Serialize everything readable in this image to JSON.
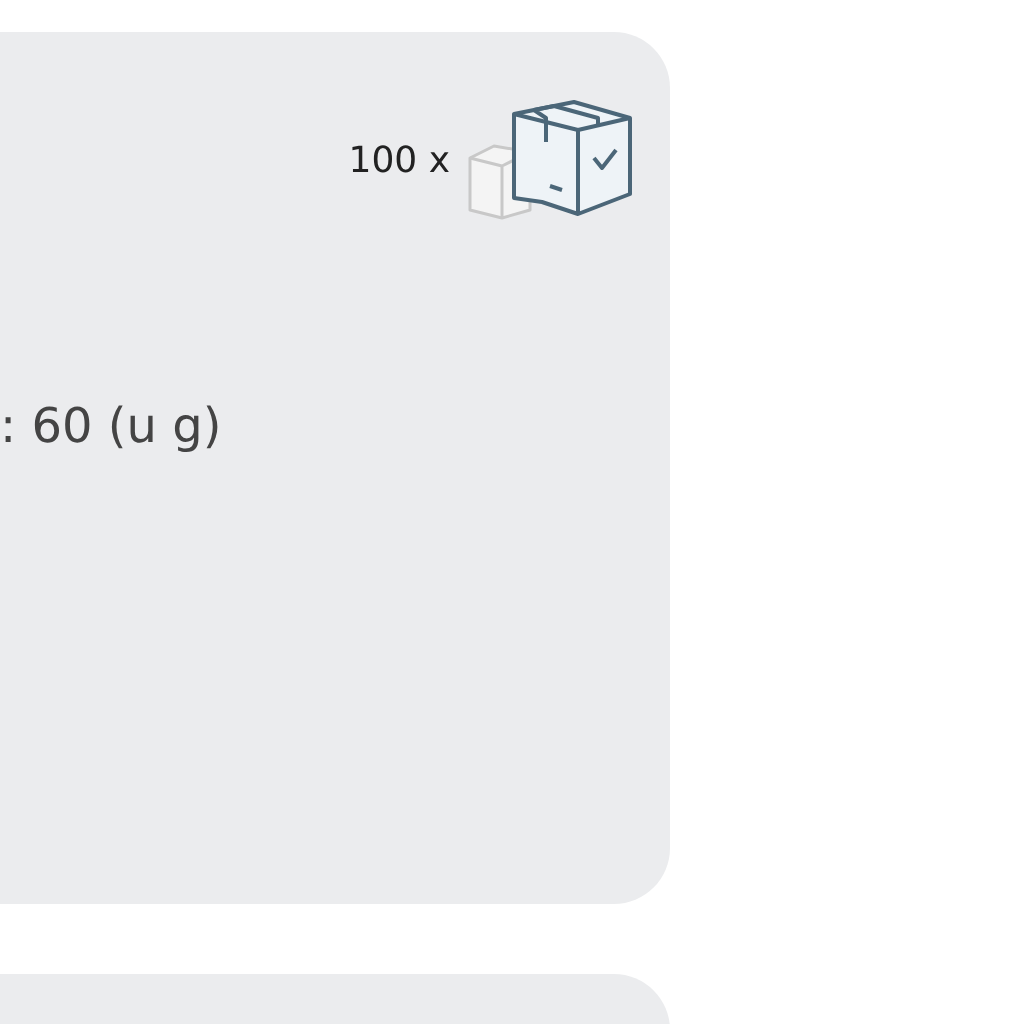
{
  "cards": [
    {
      "kind": "card",
      "quantity": "100 x",
      "detail": ": 60 (u g)"
    },
    {
      "kind": "card"
    }
  ]
}
